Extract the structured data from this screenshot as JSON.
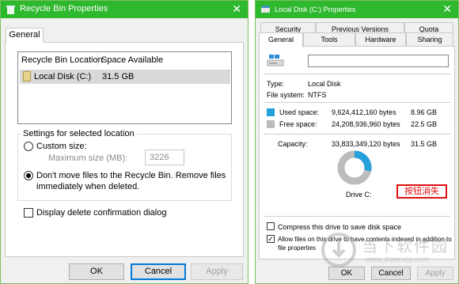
{
  "left_window": {
    "title": "Recycle Bin Properties",
    "close_glyph": "✕",
    "tab": "General",
    "list": {
      "col_location": "Recycle Bin Location",
      "col_space": "Space Available",
      "row_location": "Local Disk (C:)",
      "row_space": "31.5 GB"
    },
    "settings": {
      "label": "Settings for selected location",
      "custom_size": "Custom size:",
      "max_size_label": "Maximum size (MB):",
      "max_size_value": "3226",
      "dont_move_line1": "Don't move files to the Recycle Bin. Remove files",
      "dont_move_line2": "immediately when deleted."
    },
    "confirm_dialog": "Display delete confirmation dialog",
    "buttons": {
      "ok": "OK",
      "cancel": "Cancel",
      "apply": "Apply"
    }
  },
  "right_window": {
    "title": "Local Disk (C:) Properties",
    "close_glyph": "✕",
    "tabs_row1": [
      "Security",
      "Previous Versions",
      "Quota"
    ],
    "tabs_row2": [
      "General",
      "Tools",
      "Hardware",
      "Sharing"
    ],
    "type_label": "Type:",
    "type_value": "Local Disk",
    "fs_label": "File system:",
    "fs_value": "NTFS",
    "used_label": "Used space:",
    "used_bytes": "9,624,412,160 bytes",
    "used_gb": "8.96 GB",
    "free_label": "Free space:",
    "free_bytes": "24,208,936,960 bytes",
    "free_gb": "22.5 GB",
    "capacity_label": "Capacity:",
    "capacity_bytes": "33,833,349,120 bytes",
    "capacity_gb": "31.5 GB",
    "drive_label": "Drive C:",
    "red_note": "按钮消失",
    "compress": "Compress this drive to save disk space",
    "index_line1": "Allow files on this drive to have contents indexed in addition to",
    "index_line2": "file properties",
    "used_fraction": 0.284,
    "colors": {
      "used": "#26a0da",
      "free": "#bcbcbc"
    },
    "buttons": {
      "ok": "OK",
      "cancel": "Cancel",
      "apply": "Apply"
    }
  },
  "watermark": {
    "cn": "当下软件园",
    "url": "www.downxia.com"
  }
}
